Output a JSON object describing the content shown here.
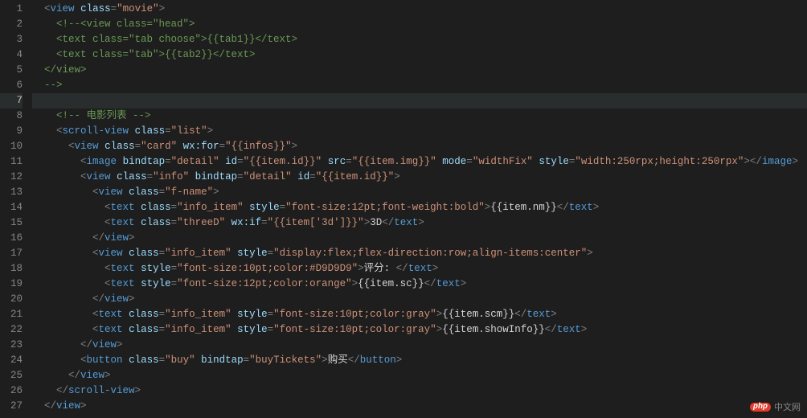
{
  "highlightedLine": 7,
  "lines": [
    {
      "n": 1,
      "indent": 1,
      "tokens": [
        {
          "t": "br",
          "v": "<"
        },
        {
          "t": "tag",
          "v": "view"
        },
        {
          "t": "txt",
          "v": " "
        },
        {
          "t": "attr",
          "v": "class"
        },
        {
          "t": "br",
          "v": "="
        },
        {
          "t": "str",
          "v": "\"movie\""
        },
        {
          "t": "br",
          "v": ">"
        }
      ]
    },
    {
      "n": 2,
      "indent": 2,
      "tokens": [
        {
          "t": "cmt",
          "v": "<!--<view class=\"head\">"
        }
      ]
    },
    {
      "n": 3,
      "indent": 2,
      "tokens": [
        {
          "t": "cmt",
          "v": "<text class=\"tab choose\">{{tab1}}</text>"
        }
      ]
    },
    {
      "n": 4,
      "indent": 2,
      "tokens": [
        {
          "t": "cmt",
          "v": "<text class=\"tab\">{{tab2}}</text>"
        }
      ]
    },
    {
      "n": 5,
      "indent": 1,
      "tokens": [
        {
          "t": "cmt",
          "v": "</view>"
        }
      ]
    },
    {
      "n": 6,
      "indent": 1,
      "tokens": [
        {
          "t": "cmt",
          "v": "-->"
        }
      ]
    },
    {
      "n": 7,
      "indent": 1,
      "tokens": []
    },
    {
      "n": 8,
      "indent": 2,
      "tokens": [
        {
          "t": "cmt",
          "v": "<!-- 电影列表 -->"
        }
      ]
    },
    {
      "n": 9,
      "indent": 2,
      "tokens": [
        {
          "t": "br",
          "v": "<"
        },
        {
          "t": "tag",
          "v": "scroll-view"
        },
        {
          "t": "txt",
          "v": " "
        },
        {
          "t": "attr",
          "v": "class"
        },
        {
          "t": "br",
          "v": "="
        },
        {
          "t": "str",
          "v": "\"list\""
        },
        {
          "t": "br",
          "v": ">"
        }
      ]
    },
    {
      "n": 10,
      "indent": 3,
      "tokens": [
        {
          "t": "br",
          "v": "<"
        },
        {
          "t": "tag",
          "v": "view"
        },
        {
          "t": "txt",
          "v": " "
        },
        {
          "t": "attr",
          "v": "class"
        },
        {
          "t": "br",
          "v": "="
        },
        {
          "t": "str",
          "v": "\"card\""
        },
        {
          "t": "txt",
          "v": " "
        },
        {
          "t": "attr",
          "v": "wx:for"
        },
        {
          "t": "br",
          "v": "="
        },
        {
          "t": "str",
          "v": "\"{{infos}}\""
        },
        {
          "t": "br",
          "v": ">"
        }
      ]
    },
    {
      "n": 11,
      "indent": 4,
      "tokens": [
        {
          "t": "br",
          "v": "<"
        },
        {
          "t": "tag",
          "v": "image"
        },
        {
          "t": "txt",
          "v": " "
        },
        {
          "t": "attr",
          "v": "bindtap"
        },
        {
          "t": "br",
          "v": "="
        },
        {
          "t": "str",
          "v": "\"detail\""
        },
        {
          "t": "txt",
          "v": " "
        },
        {
          "t": "attr",
          "v": "id"
        },
        {
          "t": "br",
          "v": "="
        },
        {
          "t": "str",
          "v": "\"{{item.id}}\""
        },
        {
          "t": "txt",
          "v": " "
        },
        {
          "t": "attr",
          "v": "src"
        },
        {
          "t": "br",
          "v": "="
        },
        {
          "t": "str",
          "v": "\"{{item.img}}\""
        },
        {
          "t": "txt",
          "v": " "
        },
        {
          "t": "attr",
          "v": "mode"
        },
        {
          "t": "br",
          "v": "="
        },
        {
          "t": "str",
          "v": "\"widthFix\""
        },
        {
          "t": "txt",
          "v": " "
        },
        {
          "t": "attr",
          "v": "style"
        },
        {
          "t": "br",
          "v": "="
        },
        {
          "t": "str",
          "v": "\"width:250rpx;height:250rpx\""
        },
        {
          "t": "br",
          "v": "></"
        },
        {
          "t": "tag",
          "v": "image"
        },
        {
          "t": "br",
          "v": ">"
        }
      ]
    },
    {
      "n": 12,
      "indent": 4,
      "tokens": [
        {
          "t": "br",
          "v": "<"
        },
        {
          "t": "tag",
          "v": "view"
        },
        {
          "t": "txt",
          "v": " "
        },
        {
          "t": "attr",
          "v": "class"
        },
        {
          "t": "br",
          "v": "="
        },
        {
          "t": "str",
          "v": "\"info\""
        },
        {
          "t": "txt",
          "v": " "
        },
        {
          "t": "attr",
          "v": "bindtap"
        },
        {
          "t": "br",
          "v": "="
        },
        {
          "t": "str",
          "v": "\"detail\""
        },
        {
          "t": "txt",
          "v": " "
        },
        {
          "t": "attr",
          "v": "id"
        },
        {
          "t": "br",
          "v": "="
        },
        {
          "t": "str",
          "v": "\"{{item.id}}\""
        },
        {
          "t": "br",
          "v": ">"
        }
      ]
    },
    {
      "n": 13,
      "indent": 5,
      "tokens": [
        {
          "t": "br",
          "v": "<"
        },
        {
          "t": "tag",
          "v": "view"
        },
        {
          "t": "txt",
          "v": " "
        },
        {
          "t": "attr",
          "v": "class"
        },
        {
          "t": "br",
          "v": "="
        },
        {
          "t": "str",
          "v": "\"f-name\""
        },
        {
          "t": "br",
          "v": ">"
        }
      ]
    },
    {
      "n": 14,
      "indent": 6,
      "tokens": [
        {
          "t": "br",
          "v": "<"
        },
        {
          "t": "tag",
          "v": "text"
        },
        {
          "t": "txt",
          "v": " "
        },
        {
          "t": "attr",
          "v": "class"
        },
        {
          "t": "br",
          "v": "="
        },
        {
          "t": "str",
          "v": "\"info_item\""
        },
        {
          "t": "txt",
          "v": " "
        },
        {
          "t": "attr",
          "v": "style"
        },
        {
          "t": "br",
          "v": "="
        },
        {
          "t": "str",
          "v": "\"font-size:12pt;font-weight:bold\""
        },
        {
          "t": "br",
          "v": ">"
        },
        {
          "t": "txt",
          "v": "{{item.nm}}"
        },
        {
          "t": "br",
          "v": "</"
        },
        {
          "t": "tag",
          "v": "text"
        },
        {
          "t": "br",
          "v": ">"
        }
      ]
    },
    {
      "n": 15,
      "indent": 6,
      "tokens": [
        {
          "t": "br",
          "v": "<"
        },
        {
          "t": "tag",
          "v": "text"
        },
        {
          "t": "txt",
          "v": " "
        },
        {
          "t": "attr",
          "v": "class"
        },
        {
          "t": "br",
          "v": "="
        },
        {
          "t": "str",
          "v": "\"threeD\""
        },
        {
          "t": "txt",
          "v": " "
        },
        {
          "t": "attr",
          "v": "wx:if"
        },
        {
          "t": "br",
          "v": "="
        },
        {
          "t": "str",
          "v": "\"{{item['3d']}}\""
        },
        {
          "t": "br",
          "v": ">"
        },
        {
          "t": "txt",
          "v": "3D"
        },
        {
          "t": "br",
          "v": "</"
        },
        {
          "t": "tag",
          "v": "text"
        },
        {
          "t": "br",
          "v": ">"
        }
      ]
    },
    {
      "n": 16,
      "indent": 5,
      "tokens": [
        {
          "t": "br",
          "v": "</"
        },
        {
          "t": "tag",
          "v": "view"
        },
        {
          "t": "br",
          "v": ">"
        }
      ]
    },
    {
      "n": 17,
      "indent": 5,
      "tokens": [
        {
          "t": "br",
          "v": "<"
        },
        {
          "t": "tag",
          "v": "view"
        },
        {
          "t": "txt",
          "v": " "
        },
        {
          "t": "attr",
          "v": "class"
        },
        {
          "t": "br",
          "v": "="
        },
        {
          "t": "str",
          "v": "\"info_item\""
        },
        {
          "t": "txt",
          "v": " "
        },
        {
          "t": "attr",
          "v": "style"
        },
        {
          "t": "br",
          "v": "="
        },
        {
          "t": "str",
          "v": "\"display:flex;flex-direction:row;align-items:center\""
        },
        {
          "t": "br",
          "v": ">"
        }
      ]
    },
    {
      "n": 18,
      "indent": 6,
      "tokens": [
        {
          "t": "br",
          "v": "<"
        },
        {
          "t": "tag",
          "v": "text"
        },
        {
          "t": "txt",
          "v": " "
        },
        {
          "t": "attr",
          "v": "style"
        },
        {
          "t": "br",
          "v": "="
        },
        {
          "t": "str",
          "v": "\"font-size:10pt;color:#D9D9D9\""
        },
        {
          "t": "br",
          "v": ">"
        },
        {
          "t": "txt",
          "v": "评分: "
        },
        {
          "t": "br",
          "v": "</"
        },
        {
          "t": "tag",
          "v": "text"
        },
        {
          "t": "br",
          "v": ">"
        }
      ]
    },
    {
      "n": 19,
      "indent": 6,
      "tokens": [
        {
          "t": "br",
          "v": "<"
        },
        {
          "t": "tag",
          "v": "text"
        },
        {
          "t": "txt",
          "v": " "
        },
        {
          "t": "attr",
          "v": "style"
        },
        {
          "t": "br",
          "v": "="
        },
        {
          "t": "str",
          "v": "\"font-size:12pt;color:orange\""
        },
        {
          "t": "br",
          "v": ">"
        },
        {
          "t": "txt",
          "v": "{{item.sc}}"
        },
        {
          "t": "br",
          "v": "</"
        },
        {
          "t": "tag",
          "v": "text"
        },
        {
          "t": "br",
          "v": ">"
        }
      ]
    },
    {
      "n": 20,
      "indent": 5,
      "tokens": [
        {
          "t": "br",
          "v": "</"
        },
        {
          "t": "tag",
          "v": "view"
        },
        {
          "t": "br",
          "v": ">"
        }
      ]
    },
    {
      "n": 21,
      "indent": 5,
      "tokens": [
        {
          "t": "br",
          "v": "<"
        },
        {
          "t": "tag",
          "v": "text"
        },
        {
          "t": "txt",
          "v": " "
        },
        {
          "t": "attr",
          "v": "class"
        },
        {
          "t": "br",
          "v": "="
        },
        {
          "t": "str",
          "v": "\"info_item\""
        },
        {
          "t": "txt",
          "v": " "
        },
        {
          "t": "attr",
          "v": "style"
        },
        {
          "t": "br",
          "v": "="
        },
        {
          "t": "str",
          "v": "\"font-size:10pt;color:gray\""
        },
        {
          "t": "br",
          "v": ">"
        },
        {
          "t": "txt",
          "v": "{{item.scm}}"
        },
        {
          "t": "br",
          "v": "</"
        },
        {
          "t": "tag",
          "v": "text"
        },
        {
          "t": "br",
          "v": ">"
        }
      ]
    },
    {
      "n": 22,
      "indent": 5,
      "tokens": [
        {
          "t": "br",
          "v": "<"
        },
        {
          "t": "tag",
          "v": "text"
        },
        {
          "t": "txt",
          "v": " "
        },
        {
          "t": "attr",
          "v": "class"
        },
        {
          "t": "br",
          "v": "="
        },
        {
          "t": "str",
          "v": "\"info_item\""
        },
        {
          "t": "txt",
          "v": " "
        },
        {
          "t": "attr",
          "v": "style"
        },
        {
          "t": "br",
          "v": "="
        },
        {
          "t": "str",
          "v": "\"font-size:10pt;color:gray\""
        },
        {
          "t": "br",
          "v": ">"
        },
        {
          "t": "txt",
          "v": "{{item.showInfo}}"
        },
        {
          "t": "br",
          "v": "</"
        },
        {
          "t": "tag",
          "v": "text"
        },
        {
          "t": "br",
          "v": ">"
        }
      ]
    },
    {
      "n": 23,
      "indent": 4,
      "tokens": [
        {
          "t": "br",
          "v": "</"
        },
        {
          "t": "tag",
          "v": "view"
        },
        {
          "t": "br",
          "v": ">"
        }
      ]
    },
    {
      "n": 24,
      "indent": 4,
      "tokens": [
        {
          "t": "br",
          "v": "<"
        },
        {
          "t": "tag",
          "v": "button"
        },
        {
          "t": "txt",
          "v": " "
        },
        {
          "t": "attr",
          "v": "class"
        },
        {
          "t": "br",
          "v": "="
        },
        {
          "t": "str",
          "v": "\"buy\""
        },
        {
          "t": "txt",
          "v": " "
        },
        {
          "t": "attr",
          "v": "bindtap"
        },
        {
          "t": "br",
          "v": "="
        },
        {
          "t": "str",
          "v": "\"buyTickets\""
        },
        {
          "t": "br",
          "v": ">"
        },
        {
          "t": "txt",
          "v": "购买"
        },
        {
          "t": "br",
          "v": "</"
        },
        {
          "t": "tag",
          "v": "button"
        },
        {
          "t": "br",
          "v": ">"
        }
      ]
    },
    {
      "n": 25,
      "indent": 3,
      "tokens": [
        {
          "t": "br",
          "v": "</"
        },
        {
          "t": "tag",
          "v": "view"
        },
        {
          "t": "br",
          "v": ">"
        }
      ]
    },
    {
      "n": 26,
      "indent": 2,
      "tokens": [
        {
          "t": "br",
          "v": "</"
        },
        {
          "t": "tag",
          "v": "scroll-view"
        },
        {
          "t": "br",
          "v": ">"
        }
      ]
    },
    {
      "n": 27,
      "indent": 1,
      "tokens": [
        {
          "t": "br",
          "v": "</"
        },
        {
          "t": "tag",
          "v": "view"
        },
        {
          "t": "br",
          "v": ">"
        }
      ]
    }
  ],
  "watermark": {
    "logo": "php",
    "text": "中文网"
  }
}
